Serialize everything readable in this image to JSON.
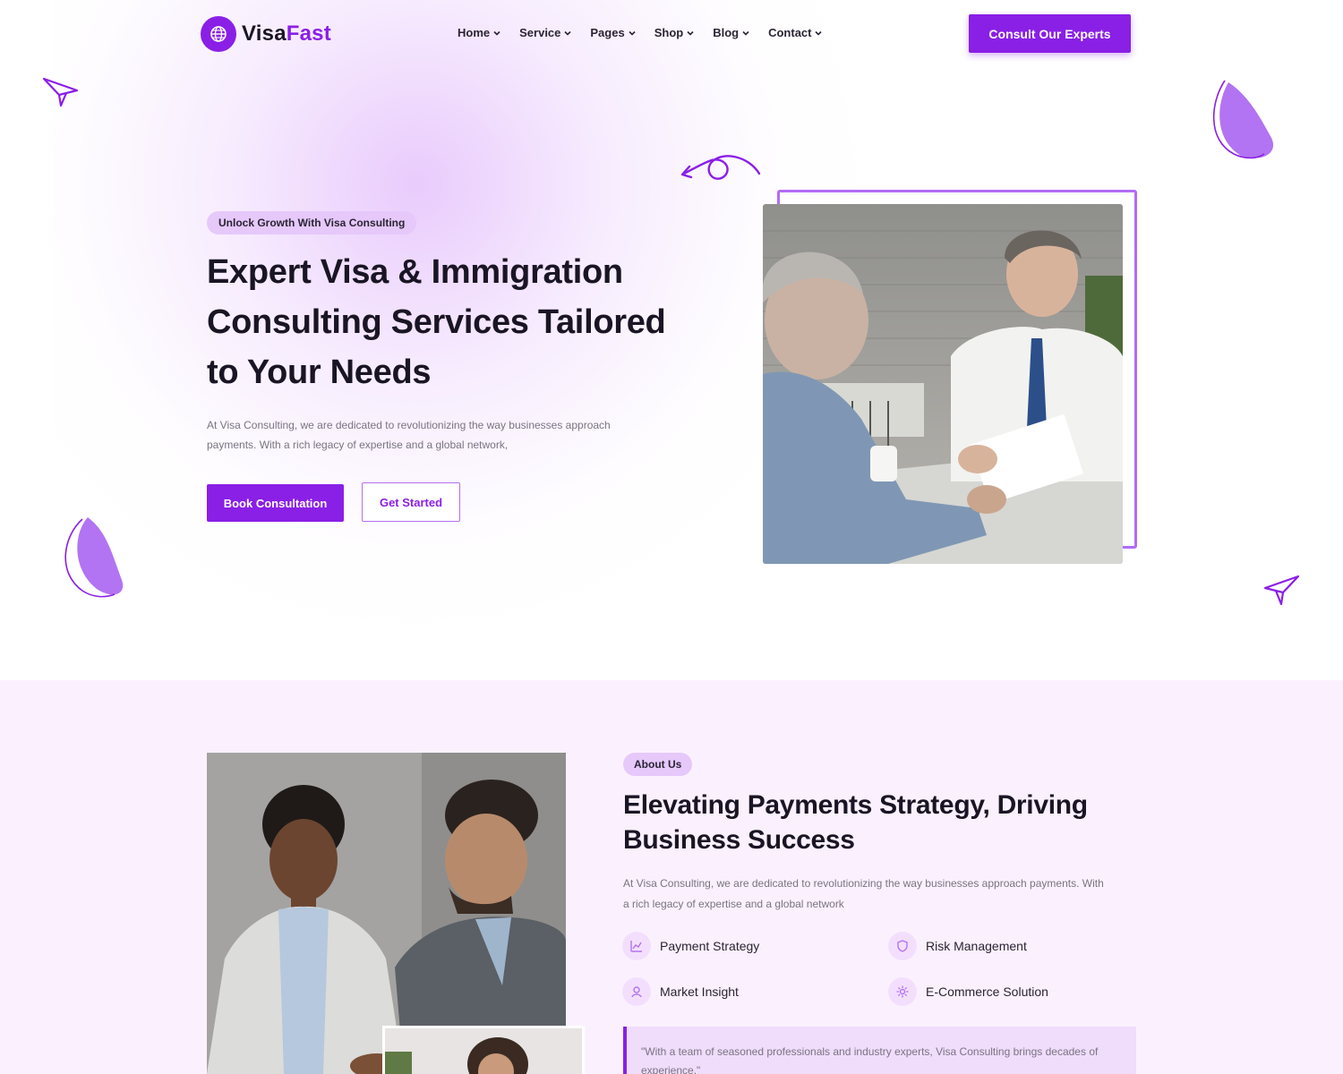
{
  "brand": {
    "name_part1": "Visa",
    "name_part2": "Fast",
    "accent": "#8a1fe6",
    "accent_light": "#e6c8fb"
  },
  "nav": {
    "items": [
      {
        "label": "Home"
      },
      {
        "label": "Service"
      },
      {
        "label": "Pages"
      },
      {
        "label": "Shop"
      },
      {
        "label": "Blog"
      },
      {
        "label": "Contact"
      }
    ],
    "cta_label": "Consult Our Experts"
  },
  "hero": {
    "badge": "Unlock Growth With Visa Consulting",
    "title": "Expert Visa & Immigration Consulting Services Tailored to Your Needs",
    "description": "At Visa Consulting, we are dedicated to revolutionizing the way businesses approach payments. With a rich legacy of expertise and a global network,",
    "primary_button": "Book Consultation",
    "secondary_button": "Get Started"
  },
  "about": {
    "badge": "About Us",
    "title": "Elevating Payments Strategy, Driving Business Success",
    "description": "At Visa Consulting, we are dedicated to revolutionizing the way businesses approach payments. With a rich legacy of expertise and a global network",
    "features": [
      {
        "label": "Payment Strategy",
        "icon": "chart-icon"
      },
      {
        "label": "Risk Management",
        "icon": "shield-icon"
      },
      {
        "label": "Market Insight",
        "icon": "insight-icon"
      },
      {
        "label": "E-Commerce Solution",
        "icon": "gear-icon"
      }
    ],
    "quote": "\"With a team of seasoned professionals and industry experts, Visa Consulting brings decades of experience.\""
  }
}
